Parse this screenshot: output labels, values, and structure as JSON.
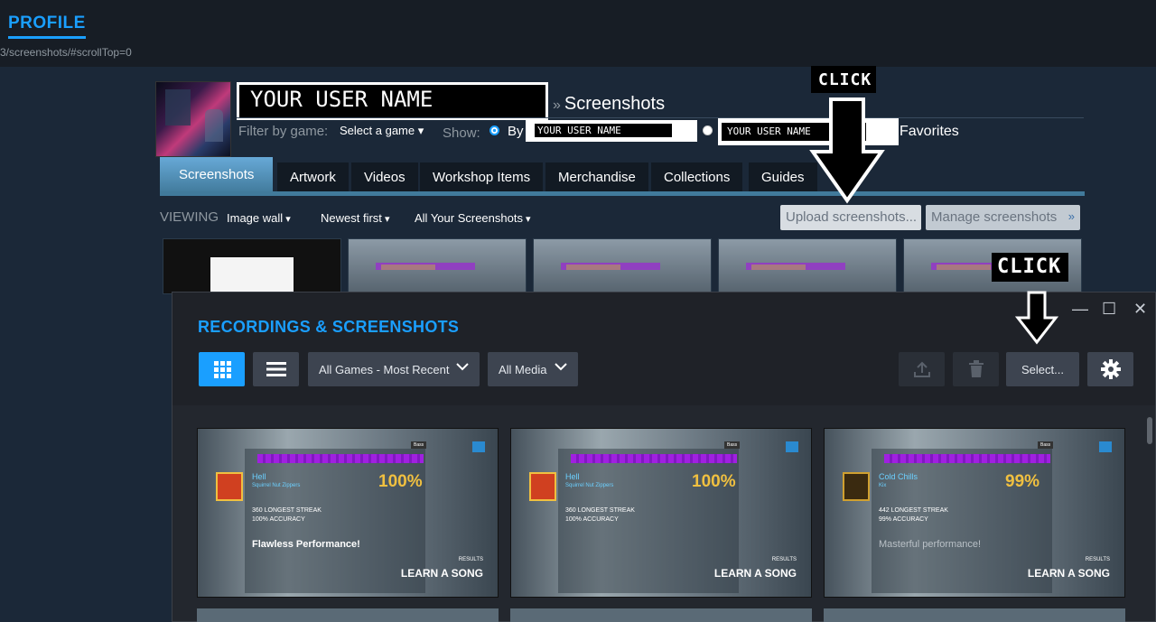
{
  "topbar": {
    "profile_label": "PROFILE",
    "url_fragment": "3/screenshots/#scrollTop=0"
  },
  "header": {
    "username": "YOUR USER NAME",
    "breadcrumb_sep": "»",
    "section": "Screenshots",
    "filter_label": "Filter by game:",
    "select_game": "Select a game ▾",
    "show_label": "Show:",
    "by_label": "By",
    "username_small_1": "YOUR USER NAME",
    "username_small_2": "YOUR USER NAME",
    "favorites_label": "Favorites"
  },
  "annotations": {
    "click_1": "CLICK",
    "click_2": "CLICK"
  },
  "tabs": [
    {
      "label": "Screenshots",
      "active": true
    },
    {
      "label": "Artwork"
    },
    {
      "label": "Videos"
    },
    {
      "label": "Workshop Items"
    },
    {
      "label": "Merchandise"
    },
    {
      "label": "Collections"
    },
    {
      "label": "Guides"
    }
  ],
  "toolbar": {
    "viewing_label": "VIEWING",
    "view_mode": "Image wall",
    "sort": "Newest first",
    "scope": "All Your Screenshots",
    "upload_label": "Upload screenshots...",
    "manage_label": "Manage screenshots",
    "manage_chevron": "»"
  },
  "overlay": {
    "title": "RECORDINGS & SCREENSHOTS",
    "games_filter": "All Games - Most Recent",
    "media_filter": "All Media",
    "select_label": "Select...",
    "minimize": "—",
    "maximize": "☐",
    "close": "✕",
    "shots": [
      {
        "song": "Hell",
        "artist": "Squirrel Nut Zippers",
        "pct": "100%",
        "streak": "360 LONGEST STREAK",
        "accuracy": "100% ACCURACY",
        "perf": "Flawless Performance!",
        "results": "RESULTS",
        "learn": "LEARN A SONG",
        "bass": "Bass"
      },
      {
        "song": "Hell",
        "artist": "Squirrel Nut Zippers",
        "pct": "100%",
        "streak": "360 LONGEST STREAK",
        "accuracy": "100% ACCURACY",
        "perf": "",
        "results": "RESULTS",
        "learn": "LEARN A SONG",
        "bass": "Bass"
      },
      {
        "song": "Cold Chills",
        "artist": "Kix",
        "pct": "99%",
        "streak": "442 LONGEST STREAK",
        "accuracy": "99% ACCURACY",
        "perf": "Masterful performance!",
        "results": "RESULTS",
        "learn": "LEARN A SONG",
        "bass": "Bass"
      }
    ]
  },
  "colors": {
    "accent": "#1a9fff",
    "page_bg": "#1b2838",
    "tab_active": "#67a9d7"
  }
}
